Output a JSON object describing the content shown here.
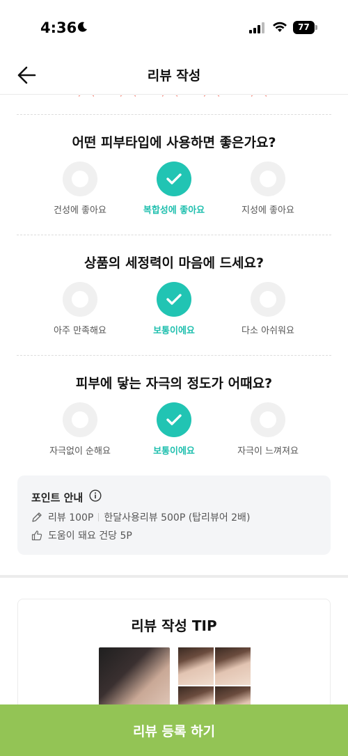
{
  "status": {
    "time": "4:36",
    "battery": "77"
  },
  "header": {
    "title": "리뷰 작성"
  },
  "questions": [
    {
      "title": "어떤 피부타입에 사용하면 좋은가요?",
      "options": [
        "건성에 좋아요",
        "복합성에 좋아요",
        "지성에 좋아요"
      ],
      "selected": 1
    },
    {
      "title": "상품의 세정력이 마음에 드세요?",
      "options": [
        "아주 만족해요",
        "보통이에요",
        "다소 아쉬워요"
      ],
      "selected": 1
    },
    {
      "title": "피부에 닿는 자극의 정도가 어때요?",
      "options": [
        "자극없이 순해요",
        "보통이에요",
        "자극이 느껴져요"
      ],
      "selected": 1
    }
  ],
  "points": {
    "title": "포인트 안내",
    "line1_a": "리뷰 100P",
    "line1_b": "한달사용리뷰 500P (탑리뷰어 2배)",
    "line2": "도움이 돼요 건당 5P"
  },
  "tip": {
    "title": "리뷰 작성 TIP"
  },
  "submit": {
    "label": "리뷰 등록 하기"
  },
  "colors": {
    "accent": "#21c4b3",
    "submit_bg": "#93c455",
    "star": "#f08a7e"
  }
}
